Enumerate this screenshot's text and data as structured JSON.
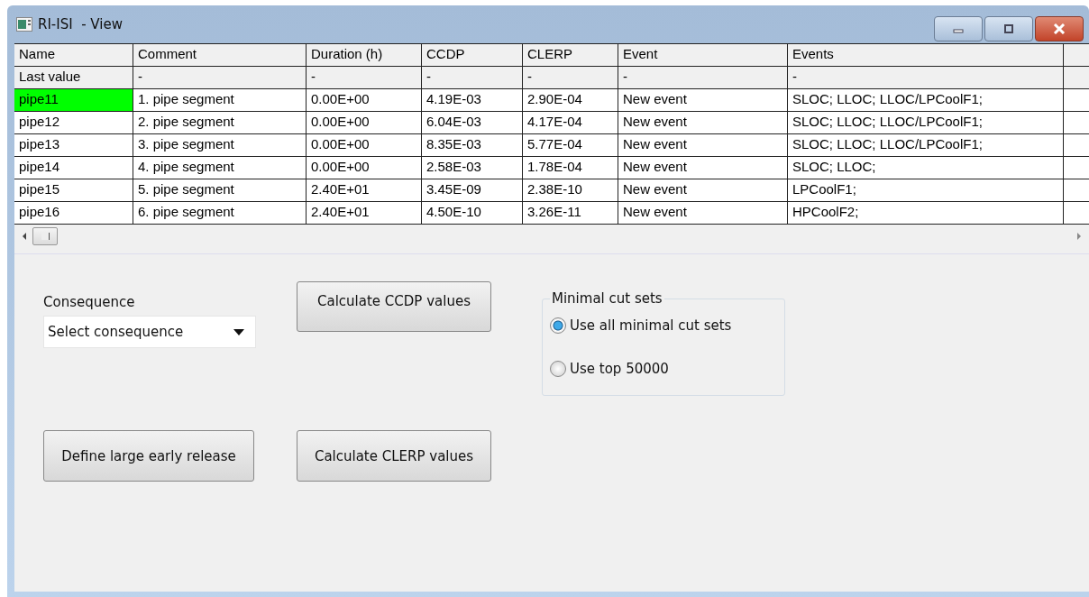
{
  "window": {
    "title": "RI-ISI  - View"
  },
  "table": {
    "columns": [
      "Name",
      "Comment",
      "Duration (h)",
      "CCDP",
      "CLERP",
      "Event",
      "Events"
    ],
    "summary_row": [
      "Last value",
      "-",
      "-",
      "-",
      "-",
      "-",
      "-"
    ],
    "rows": [
      {
        "cells": [
          "pipe11",
          "1. pipe segment",
          "0.00E+00",
          "4.19E-03",
          "2.90E-04",
          "New event",
          "SLOC; LLOC; LLOC/LPCoolF1;"
        ],
        "highlighted": true
      },
      {
        "cells": [
          "pipe12",
          "2. pipe segment",
          "0.00E+00",
          "6.04E-03",
          "4.17E-04",
          "New event",
          "SLOC; LLOC; LLOC/LPCoolF1;"
        ],
        "highlighted": false
      },
      {
        "cells": [
          "pipe13",
          "3. pipe segment",
          "0.00E+00",
          "8.35E-03",
          "5.77E-04",
          "New event",
          "SLOC; LLOC; LLOC/LPCoolF1;"
        ],
        "highlighted": false
      },
      {
        "cells": [
          "pipe14",
          "4. pipe segment",
          "0.00E+00",
          "2.58E-03",
          "1.78E-04",
          "New event",
          "SLOC; LLOC;"
        ],
        "highlighted": false
      },
      {
        "cells": [
          "pipe15",
          "5. pipe segment",
          "2.40E+01",
          "3.45E-09",
          "2.38E-10",
          "New event",
          "LPCoolF1;"
        ],
        "highlighted": false
      },
      {
        "cells": [
          "pipe16",
          "6. pipe segment",
          "2.40E+01",
          "4.50E-10",
          "3.26E-11",
          "New event",
          "HPCoolF2;"
        ],
        "highlighted": false
      }
    ]
  },
  "consequence": {
    "label": "Consequence",
    "value": "Select consequence"
  },
  "buttons": {
    "ccdp": "Calculate CCDP values",
    "ler": "Define large early release",
    "clerp": "Calculate CLERP values"
  },
  "minimal_cut_sets": {
    "title": "Minimal cut sets",
    "options": [
      {
        "label": "Use all minimal cut sets",
        "selected": true
      },
      {
        "label": "Use top 50000",
        "selected": false
      }
    ]
  }
}
